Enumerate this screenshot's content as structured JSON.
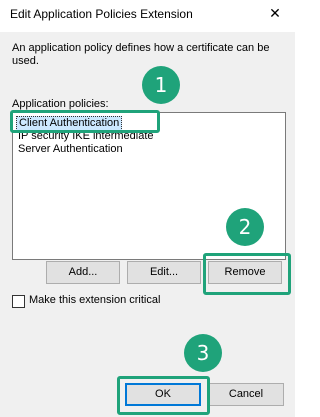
{
  "window": {
    "title": "Edit Application Policies Extension",
    "close_glyph": "✕"
  },
  "description": "An application policy defines how a certificate can be used.",
  "policies": {
    "label": "Application policies:",
    "items": [
      {
        "label": "Client Authentication",
        "selected": true
      },
      {
        "label": "IP security IKE intermediate",
        "selected": false
      },
      {
        "label": "Server Authentication",
        "selected": false
      }
    ]
  },
  "buttons": {
    "add": "Add...",
    "edit": "Edit...",
    "remove": "Remove",
    "ok": "OK",
    "cancel": "Cancel"
  },
  "critical_checkbox": {
    "label": "Make this extension critical",
    "checked": false
  },
  "annotations": {
    "step1": "1",
    "step2": "2",
    "step3": "3",
    "color": "#1fa37a"
  }
}
